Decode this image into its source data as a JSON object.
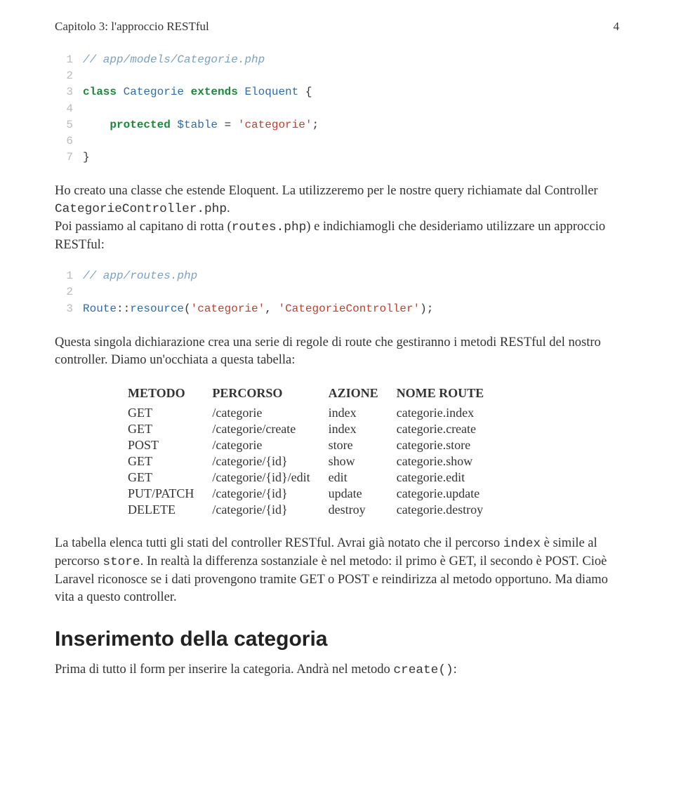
{
  "header": {
    "chapter": "Capitolo 3: l'approccio RESTful",
    "pagenum": "4"
  },
  "code1": {
    "lines": [
      {
        "n": "1",
        "tokens": [
          {
            "t": "// app/models/Categorie.php",
            "cls": "c-comment"
          }
        ]
      },
      {
        "n": "2",
        "tokens": []
      },
      {
        "n": "3",
        "tokens": [
          {
            "t": "class ",
            "cls": "c-kw"
          },
          {
            "t": "Categorie ",
            "cls": "c-ident"
          },
          {
            "t": "extends ",
            "cls": "c-kw"
          },
          {
            "t": "Eloquent ",
            "cls": "c-ident"
          },
          {
            "t": "{",
            "cls": "c-punct"
          }
        ]
      },
      {
        "n": "4",
        "tokens": []
      },
      {
        "n": "5",
        "tokens": [
          {
            "t": "    ",
            "cls": "c-plain"
          },
          {
            "t": "protected ",
            "cls": "c-kw"
          },
          {
            "t": "$table ",
            "cls": "c-ident"
          },
          {
            "t": "= ",
            "cls": "c-punct"
          },
          {
            "t": "'categorie'",
            "cls": "c-str"
          },
          {
            "t": ";",
            "cls": "c-punct"
          }
        ]
      },
      {
        "n": "6",
        "tokens": []
      },
      {
        "n": "7",
        "tokens": [
          {
            "t": "}",
            "cls": "c-punct"
          }
        ]
      }
    ]
  },
  "para1": {
    "p1a": "Ho creato una classe che estende Eloquent. La utilizzeremo per le nostre query richiamate dal Controller ",
    "p1b": "CategorieController.php",
    "p1c": ".",
    "p2a": "Poi passiamo al capitano di rotta (",
    "p2b": "routes.php",
    "p2c": ") e indichiamogli che desideriamo utilizzare un approccio RESTful:"
  },
  "code2": {
    "lines": [
      {
        "n": "1",
        "tokens": [
          {
            "t": "// app/routes.php",
            "cls": "c-comment"
          }
        ]
      },
      {
        "n": "2",
        "tokens": []
      },
      {
        "n": "3",
        "tokens": [
          {
            "t": "Route",
            "cls": "c-ident"
          },
          {
            "t": "::",
            "cls": "c-punct"
          },
          {
            "t": "resource",
            "cls": "c-ident"
          },
          {
            "t": "(",
            "cls": "c-punct"
          },
          {
            "t": "'categorie'",
            "cls": "c-str"
          },
          {
            "t": ", ",
            "cls": "c-punct"
          },
          {
            "t": "'CategorieController'",
            "cls": "c-str"
          },
          {
            "t": ");",
            "cls": "c-punct"
          }
        ]
      }
    ]
  },
  "para2": "Questa singola dichiarazione crea una serie di regole di route che gestiranno i metodi RESTful del nostro controller. Diamo un'occhiata a questa tabella:",
  "table": {
    "headers": {
      "h1": "METODO",
      "h2": "PERCORSO",
      "h3": "AZIONE",
      "h4": "NOME ROUTE"
    },
    "rows": [
      {
        "c1": "GET",
        "c2": "/categorie",
        "c3": "index",
        "c4": "categorie.index"
      },
      {
        "c1": "GET",
        "c2": "/categorie/create",
        "c3": "index",
        "c4": "categorie.create"
      },
      {
        "c1": "POST",
        "c2": "/categorie",
        "c3": "store",
        "c4": "categorie.store"
      },
      {
        "c1": "GET",
        "c2": "/categorie/{id}",
        "c3": "show",
        "c4": "categorie.show"
      },
      {
        "c1": "GET",
        "c2": "/categorie/{id}/edit",
        "c3": "edit",
        "c4": "categorie.edit"
      },
      {
        "c1": "PUT/PATCH",
        "c2": "/categorie/{id}",
        "c3": "update",
        "c4": "categorie.update"
      },
      {
        "c1": "DELETE",
        "c2": "/categorie/{id}",
        "c3": "destroy",
        "c4": "categorie.destroy"
      }
    ]
  },
  "para3": {
    "a": "La tabella elenca tutti gli stati del controller RESTful. Avrai già notato che il percorso ",
    "b": "index",
    "c": " è simile al percorso ",
    "d": "store",
    "e": ". In realtà la differenza sostanziale è nel metodo: il primo è GET, il secondo è POST. Cioè Laravel riconosce se i dati provengono tramite GET o POST e reindirizza al metodo opportuno. Ma diamo vita a questo controller."
  },
  "section_title": "Inserimento della categoria",
  "para4": {
    "a": "Prima di tutto il form per inserire la categoria. Andrà nel metodo ",
    "b": "create()",
    "c": ":"
  }
}
